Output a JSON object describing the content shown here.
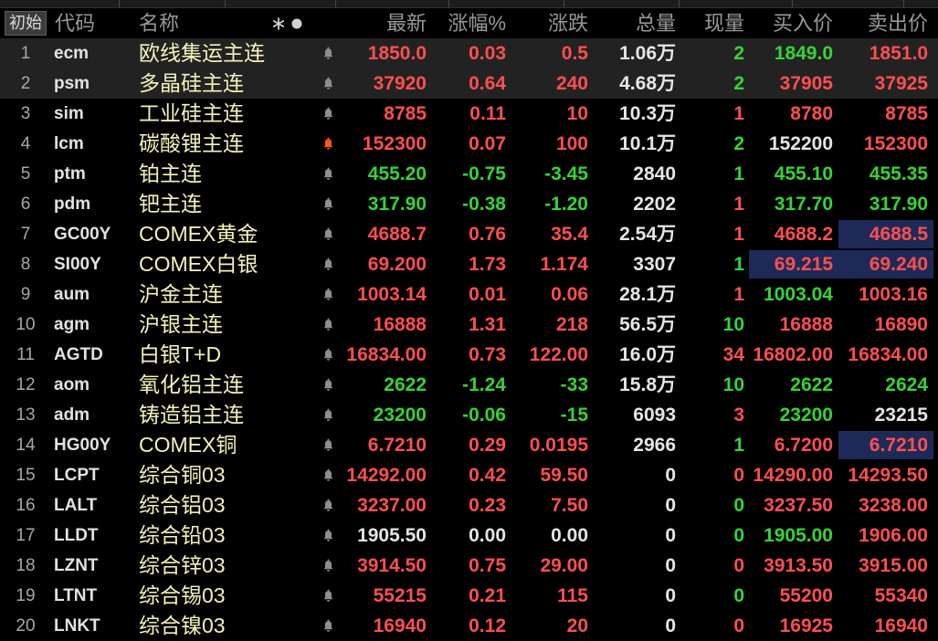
{
  "header": {
    "init_button": "初始",
    "code": "代码",
    "name": "名称",
    "last": "最新",
    "change_pct": "涨幅%",
    "change": "涨跌",
    "volume": "总量",
    "current_volume": "现量",
    "bid": "买入价",
    "ask": "卖出价"
  },
  "icons": {
    "column_toggle": "asterisk-dot-icon",
    "alert": "bell-icon"
  },
  "colors": {
    "up": "#ff4f4f",
    "down": "#35d435",
    "flat": "#e4e4e4",
    "name": "#f3f3b9",
    "flash_bg": "#1d2a58",
    "selected_bg": "#222222",
    "alert_on": "#ff5522",
    "alert_off": "#8e8e8e"
  },
  "rows": [
    {
      "no": "1",
      "code": "ecm",
      "name": "欧线集运主连",
      "selected": true,
      "alert_on": false,
      "last": "1850.0",
      "pct": "0.03",
      "chg": "0.5",
      "dir": 1,
      "vol": "1.06万",
      "cur": "2",
      "cur_dir": -1,
      "bid": "1849.0",
      "bid_dir": -1,
      "ask": "1851.0",
      "ask_dir": 1
    },
    {
      "no": "2",
      "code": "psm",
      "name": "多晶硅主连",
      "selected": true,
      "alert_on": false,
      "last": "37920",
      "pct": "0.64",
      "chg": "240",
      "dir": 1,
      "vol": "4.68万",
      "cur": "2",
      "cur_dir": -1,
      "bid": "37905",
      "bid_dir": 1,
      "ask": "37925",
      "ask_dir": 1
    },
    {
      "no": "3",
      "code": "sim",
      "name": "工业硅主连",
      "alert_on": false,
      "last": "8785",
      "pct": "0.11",
      "chg": "10",
      "dir": 1,
      "vol": "10.3万",
      "cur": "1",
      "cur_dir": 1,
      "bid": "8780",
      "bid_dir": 1,
      "ask": "8785",
      "ask_dir": 1
    },
    {
      "no": "4",
      "code": "lcm",
      "name": "碳酸锂主连",
      "alert_on": true,
      "last": "152300",
      "pct": "0.07",
      "chg": "100",
      "dir": 1,
      "vol": "10.1万",
      "cur": "2",
      "cur_dir": -1,
      "bid": "152200",
      "bid_dir": 0,
      "ask": "152300",
      "ask_dir": 1
    },
    {
      "no": "5",
      "code": "ptm",
      "name": "铂主连",
      "alert_on": false,
      "last": "455.20",
      "pct": "-0.75",
      "chg": "-3.45",
      "dir": -1,
      "vol": "2840",
      "cur": "1",
      "cur_dir": -1,
      "bid": "455.10",
      "bid_dir": -1,
      "ask": "455.35",
      "ask_dir": -1
    },
    {
      "no": "6",
      "code": "pdm",
      "name": "钯主连",
      "alert_on": false,
      "last": "317.90",
      "pct": "-0.38",
      "chg": "-1.20",
      "dir": -1,
      "vol": "2202",
      "cur": "1",
      "cur_dir": 1,
      "bid": "317.70",
      "bid_dir": -1,
      "ask": "317.90",
      "ask_dir": -1
    },
    {
      "no": "7",
      "code": "GC00Y",
      "name": "COMEX黄金",
      "alert_on": false,
      "last": "4688.7",
      "pct": "0.76",
      "chg": "35.4",
      "dir": 1,
      "vol": "2.54万",
      "cur": "1",
      "cur_dir": 1,
      "bid": "4688.2",
      "bid_dir": 1,
      "ask": "4688.5",
      "ask_dir": 1,
      "ask_flash": true
    },
    {
      "no": "8",
      "code": "SI00Y",
      "name": "COMEX白银",
      "alert_on": false,
      "last": "69.200",
      "pct": "1.73",
      "chg": "1.174",
      "dir": 1,
      "vol": "3307",
      "cur": "1",
      "cur_dir": -1,
      "bid": "69.215",
      "bid_dir": 1,
      "bid_flash": true,
      "ask": "69.240",
      "ask_dir": 1,
      "ask_flash": true
    },
    {
      "no": "9",
      "code": "aum",
      "name": "沪金主连",
      "alert_on": false,
      "last": "1003.14",
      "pct": "0.01",
      "chg": "0.06",
      "dir": 1,
      "vol": "28.1万",
      "cur": "1",
      "cur_dir": 1,
      "bid": "1003.04",
      "bid_dir": -1,
      "ask": "1003.16",
      "ask_dir": 1
    },
    {
      "no": "10",
      "code": "agm",
      "name": "沪银主连",
      "alert_on": false,
      "last": "16888",
      "pct": "1.31",
      "chg": "218",
      "dir": 1,
      "vol": "56.5万",
      "cur": "10",
      "cur_dir": -1,
      "bid": "16888",
      "bid_dir": 1,
      "ask": "16890",
      "ask_dir": 1
    },
    {
      "no": "11",
      "code": "AGTD",
      "name": "白银T+D",
      "alert_on": false,
      "last": "16834.00",
      "pct": "0.73",
      "chg": "122.00",
      "dir": 1,
      "vol": "16.0万",
      "cur": "34",
      "cur_dir": 1,
      "bid": "16802.00",
      "bid_dir": 1,
      "ask": "16834.00",
      "ask_dir": 1
    },
    {
      "no": "12",
      "code": "aom",
      "name": "氧化铝主连",
      "alert_on": false,
      "last": "2622",
      "pct": "-1.24",
      "chg": "-33",
      "dir": -1,
      "vol": "15.8万",
      "cur": "10",
      "cur_dir": -1,
      "bid": "2622",
      "bid_dir": -1,
      "ask": "2624",
      "ask_dir": -1
    },
    {
      "no": "13",
      "code": "adm",
      "name": "铸造铝主连",
      "alert_on": false,
      "last": "23200",
      "pct": "-0.06",
      "chg": "-15",
      "dir": -1,
      "vol": "6093",
      "cur": "3",
      "cur_dir": 1,
      "bid": "23200",
      "bid_dir": -1,
      "ask": "23215",
      "ask_dir": 0
    },
    {
      "no": "14",
      "code": "HG00Y",
      "name": "COMEX铜",
      "alert_on": false,
      "last": "6.7210",
      "pct": "0.29",
      "chg": "0.0195",
      "dir": 1,
      "vol": "2966",
      "cur": "1",
      "cur_dir": -1,
      "bid": "6.7200",
      "bid_dir": 1,
      "ask": "6.7210",
      "ask_dir": 1,
      "ask_flash": true
    },
    {
      "no": "15",
      "code": "LCPT",
      "name": "综合铜03",
      "alert_on": false,
      "last": "14292.00",
      "pct": "0.42",
      "chg": "59.50",
      "dir": 1,
      "vol": "0",
      "cur": "0",
      "cur_dir": 1,
      "bid": "14290.00",
      "bid_dir": 1,
      "ask": "14293.50",
      "ask_dir": 1
    },
    {
      "no": "16",
      "code": "LALT",
      "name": "综合铝03",
      "alert_on": false,
      "last": "3237.00",
      "pct": "0.23",
      "chg": "7.50",
      "dir": 1,
      "vol": "0",
      "cur": "0",
      "cur_dir": -1,
      "bid": "3237.50",
      "bid_dir": 1,
      "ask": "3238.00",
      "ask_dir": 1
    },
    {
      "no": "17",
      "code": "LLDT",
      "name": "综合铅03",
      "alert_on": false,
      "last": "1905.50",
      "pct": "0.00",
      "chg": "0.00",
      "dir": 0,
      "vol": "0",
      "cur": "0",
      "cur_dir": -1,
      "bid": "1905.00",
      "bid_dir": -1,
      "ask": "1906.00",
      "ask_dir": 1
    },
    {
      "no": "18",
      "code": "LZNT",
      "name": "综合锌03",
      "alert_on": false,
      "last": "3914.50",
      "pct": "0.75",
      "chg": "29.00",
      "dir": 1,
      "vol": "0",
      "cur": "0",
      "cur_dir": 1,
      "bid": "3913.50",
      "bid_dir": 1,
      "ask": "3915.00",
      "ask_dir": 1
    },
    {
      "no": "19",
      "code": "LTNT",
      "name": "综合锡03",
      "alert_on": false,
      "last": "55215",
      "pct": "0.21",
      "chg": "115",
      "dir": 1,
      "vol": "0",
      "cur": "0",
      "cur_dir": -1,
      "bid": "55200",
      "bid_dir": 1,
      "ask": "55340",
      "ask_dir": 1
    },
    {
      "no": "20",
      "code": "LNKT",
      "name": "综合镍03",
      "alert_on": false,
      "last": "16940",
      "pct": "0.12",
      "chg": "20",
      "dir": 1,
      "vol": "0",
      "cur": "0",
      "cur_dir": 1,
      "bid": "16925",
      "bid_dir": 1,
      "ask": "16940",
      "ask_dir": 1
    }
  ]
}
